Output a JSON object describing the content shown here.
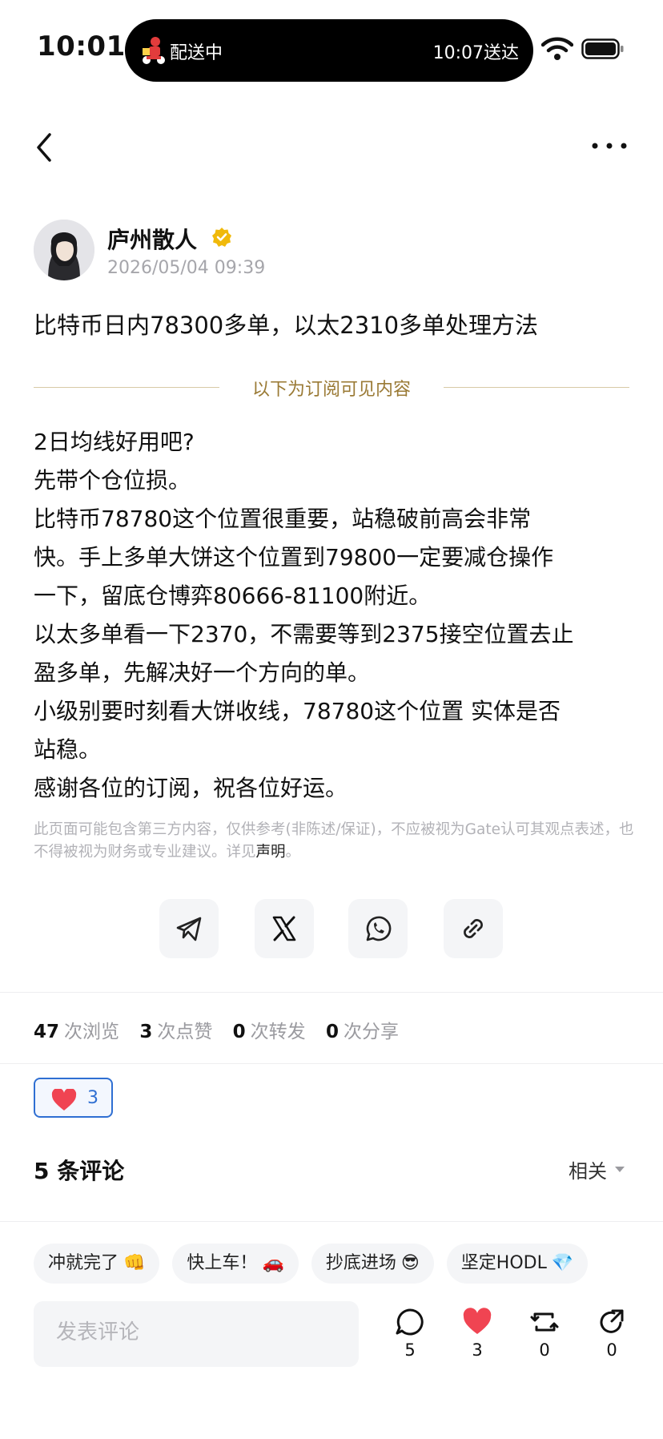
{
  "status_bar": {
    "time": "10:01",
    "island_label": "配送中",
    "island_eta": "10:07送达"
  },
  "author": {
    "name": "庐州散人",
    "timestamp": "2026/05/04 09:39"
  },
  "post": {
    "title": "比特币日内78300多单，以太2310多单处理方法",
    "subscriber_divider": "以下为订阅可见内容",
    "body_lines": [
      "2日均线好用吧?",
      "先带个仓位损。",
      "比特币78780这个位置很重要，站稳破前高会非常",
      "快。手上多单大饼这个位置到79800一定要减仓操作",
      "一下，留底仓博弈80666-81100附近。",
      "以太多单看一下2370，不需要等到2375接空位置去止",
      "盈多单，先解决好一个方向的单。",
      "小级别要时刻看大饼收线，78780这个位置 实体是否",
      "站稳。",
      "感谢各位的订阅，祝各位好运。"
    ],
    "disclaimer": "此页面可能包含第三方内容，仅供参考(非陈述/保证)，不应被视为Gate认可其观点表述，也不得被视为财务或专业建议。详见",
    "disclaimer_link": "声明",
    "disclaimer_end": "。"
  },
  "share": [
    "telegram-icon",
    "x-icon",
    "whatsapp-icon",
    "link-icon"
  ],
  "stats": {
    "views": "47",
    "views_label": "次浏览",
    "likes": "3",
    "likes_label": "次点赞",
    "reposts": "0",
    "reposts_label": "次转发",
    "shares": "0",
    "shares_label": "次分享"
  },
  "reaction": {
    "icon": "heart-icon",
    "count": "3"
  },
  "comments": {
    "title": "5 条评论",
    "sort": "相关",
    "chips": [
      {
        "label": "冲就完了",
        "emoji": "👊"
      },
      {
        "label": "快上车！",
        "emoji": "🚗"
      },
      {
        "label": "抄底进场",
        "emoji": "😎"
      },
      {
        "label": "坚定HODL",
        "emoji": "💎"
      }
    ],
    "input_placeholder": "发表评论"
  },
  "bottom_actions": {
    "comments": "5",
    "likes": "3",
    "reposts": "0",
    "shares": "0"
  },
  "colors": {
    "accent_blue": "#2f6fd2",
    "heart_red": "#f04452",
    "gold": "#9a7a35",
    "verified_gold": "#f0b90b"
  }
}
